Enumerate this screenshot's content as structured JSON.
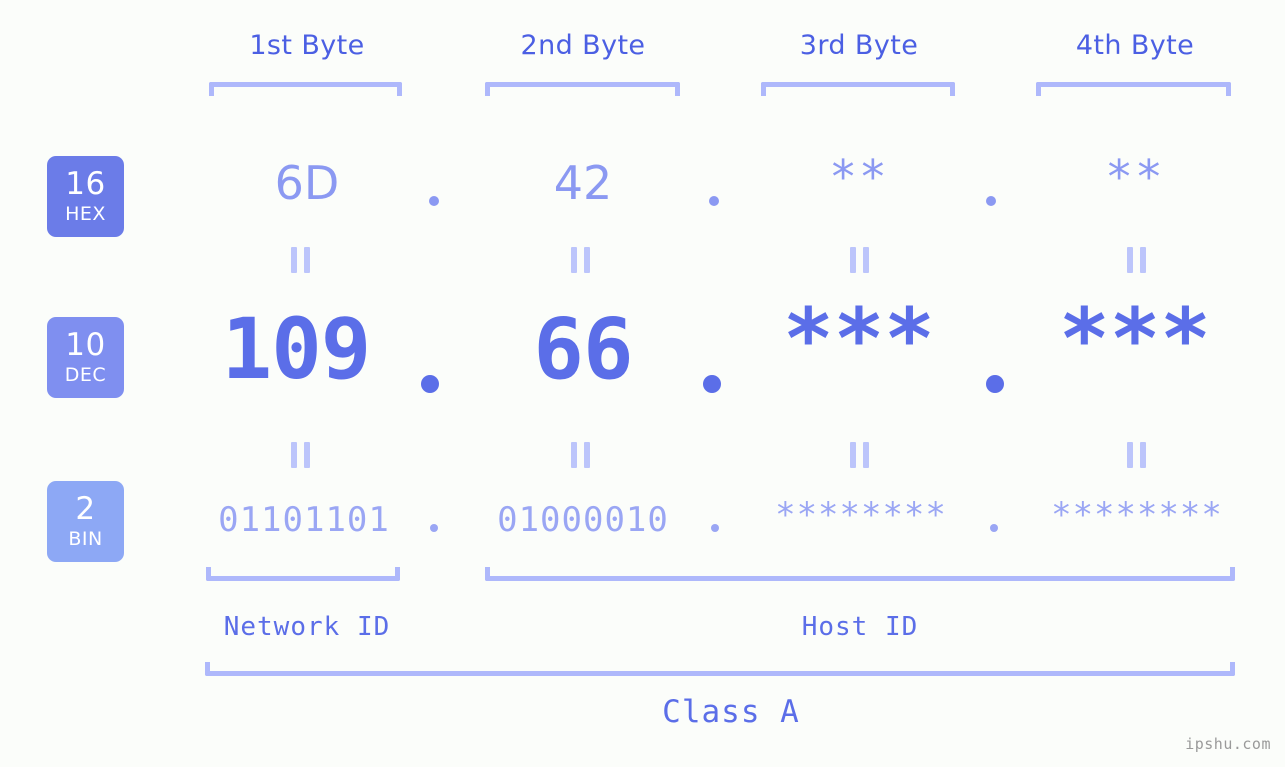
{
  "meta": {
    "watermark": "ipshu.com",
    "background_color": "#fbfdfa",
    "accent_color": "#5b6ee8",
    "accent_light": "#aeb8fb"
  },
  "headers": [
    {
      "label": "1st Byte"
    },
    {
      "label": "2nd Byte"
    },
    {
      "label": "3rd Byte"
    },
    {
      "label": "4th Byte"
    }
  ],
  "bases": [
    {
      "num": "16",
      "name": "HEX",
      "color": "#6b7ce8"
    },
    {
      "num": "10",
      "name": "DEC",
      "color": "#7f8ff0"
    },
    {
      "num": "2",
      "name": "BIN",
      "color": "#8da8f5"
    }
  ],
  "rows": {
    "hex": {
      "base_label": "HEX",
      "values": [
        "6D",
        "42",
        "**",
        "**"
      ],
      "separator": "."
    },
    "dec": {
      "base_label": "DEC",
      "values": [
        "109",
        "66",
        "***",
        "***"
      ],
      "separator": "."
    },
    "bin": {
      "base_label": "BIN",
      "values": [
        "01101101",
        "01000010",
        "********",
        "********"
      ],
      "separator": "."
    }
  },
  "equivalence_symbol": "||",
  "segments": {
    "network_id": "Network ID",
    "host_id": "Host ID",
    "class": "Class A"
  }
}
